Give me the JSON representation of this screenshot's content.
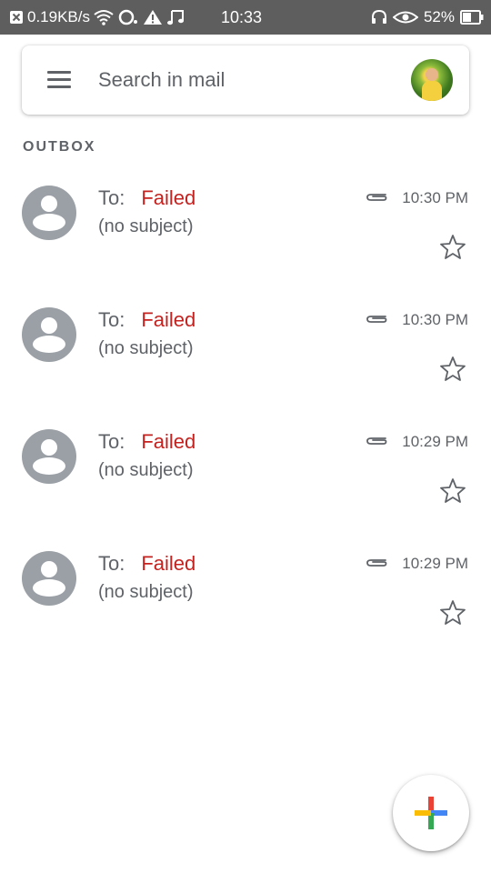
{
  "status_bar": {
    "net_speed": "0.19KB/s",
    "time": "10:33",
    "battery_percent": "52%",
    "icons": [
      "close-box-icon",
      "wifi-icon",
      "sync-icon",
      "warning-icon",
      "music-note-icon",
      "headset-icon",
      "eye-icon",
      "battery-icon"
    ]
  },
  "search": {
    "placeholder": "Search in mail",
    "menu_icon": "menu-icon",
    "account_avatar": "account-avatar"
  },
  "section": {
    "label": "OUTBOX"
  },
  "mails": [
    {
      "to_label": "To:",
      "status": "Failed",
      "subject": "(no subject)",
      "time": "10:30 PM",
      "has_attachment": true,
      "starred": false
    },
    {
      "to_label": "To:",
      "status": "Failed",
      "subject": "(no subject)",
      "time": "10:30 PM",
      "has_attachment": true,
      "starred": false
    },
    {
      "to_label": "To:",
      "status": "Failed",
      "subject": "(no subject)",
      "time": "10:29 PM",
      "has_attachment": true,
      "starred": false
    },
    {
      "to_label": "To:",
      "status": "Failed",
      "subject": "(no subject)",
      "time": "10:29 PM",
      "has_attachment": true,
      "starred": false
    }
  ],
  "fab": {
    "icon": "compose-plus-icon"
  },
  "colors": {
    "status_bar": "#5e5e5e",
    "failed": "#c5221f",
    "text_secondary": "#5f6368",
    "avatar_gray": "#9aa0a6",
    "plus_red": "#ea4335",
    "plus_blue": "#4285f4",
    "plus_green": "#34a853",
    "plus_yellow": "#fbbc04"
  }
}
